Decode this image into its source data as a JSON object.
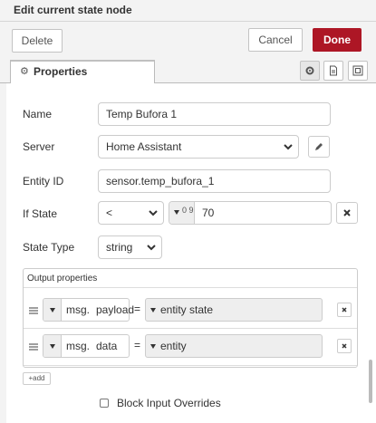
{
  "header": {
    "title": "Edit current state node"
  },
  "toolbar": {
    "delete_label": "Delete",
    "cancel_label": "Cancel",
    "done_label": "Done"
  },
  "tabs": {
    "properties_label": "Properties"
  },
  "form": {
    "name": {
      "label": "Name",
      "value": "Temp Bufora 1"
    },
    "server": {
      "label": "Server",
      "value": "Home Assistant"
    },
    "entity_id": {
      "label": "Entity ID",
      "value": "sensor.temp_bufora_1"
    },
    "if_state": {
      "label": "If State",
      "operator": "<",
      "type_glyph": "0 9",
      "value": "70"
    },
    "state_type": {
      "label": "State Type",
      "value": "string"
    }
  },
  "output": {
    "title": "Output properties",
    "rows": [
      {
        "prefix": "msg.",
        "key": "payload",
        "equals": "=",
        "value": "entity state"
      },
      {
        "prefix": "msg.",
        "key": "data",
        "equals": "=",
        "value": "entity"
      }
    ],
    "add_label": "+add"
  },
  "block_input": {
    "label": "Block Input Overrides",
    "checked": false
  },
  "colors": {
    "done": "#ad1625",
    "panel": "#ffffff",
    "chrome": "#f3f3f3"
  }
}
